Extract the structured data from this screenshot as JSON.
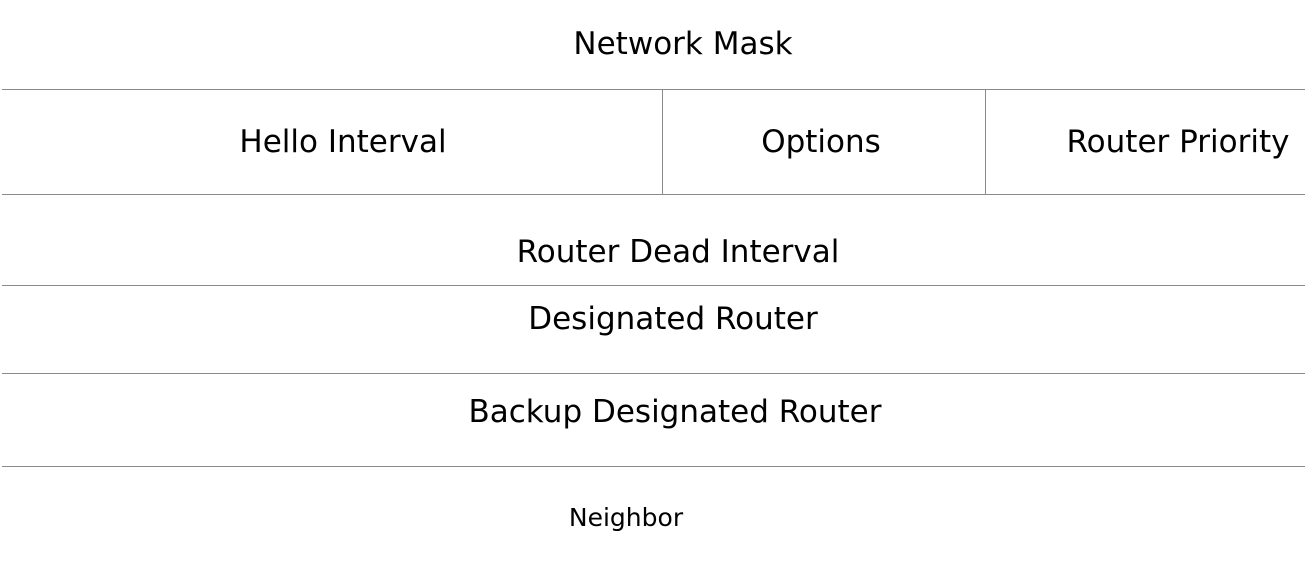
{
  "packet_fields": {
    "network_mask": "Network Mask",
    "hello_interval": "Hello Interval",
    "options": "Options",
    "router_priority": "Router Priority",
    "router_dead_interval": "Router Dead Interval",
    "designated_router": "Designated Router",
    "backup_designated_router": "Backup Designated Router",
    "neighbor": "Neighbor"
  }
}
